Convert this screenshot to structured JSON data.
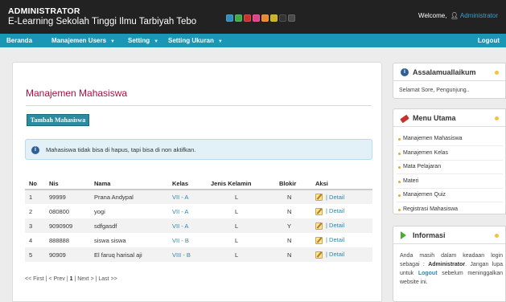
{
  "header": {
    "title_line1": "ADMINISTRATOR",
    "title_line2": "E-Learning Sekolah Tinggi Ilmu Tarbiyah Tebo",
    "welcome_label": "Welcome,",
    "user_name": "Administrator",
    "theme_colors": [
      "#2e8fbf",
      "#3dab4a",
      "#c8322e",
      "#e0428c",
      "#e9892c",
      "#c9b41f",
      "#333333",
      "#4a4a4a"
    ]
  },
  "nav": {
    "home": "Beranda",
    "users": "Manajemen Users",
    "setting": "Setting",
    "ukuran": "Setting Ukuran",
    "logout": "Logout"
  },
  "main": {
    "title": "Manajemen Mahasiswa",
    "add_button": "Tambah Mahasiswa",
    "notice_icon": "info-icon",
    "notice": "Mahasiswa tidak bisa di hapus, tapi bisa di non aktifkan.",
    "columns": [
      "No",
      "Nis",
      "Nama",
      "Kelas",
      "Jenis Kelamin",
      "Blokir",
      "Aksi"
    ],
    "rows": [
      {
        "no": "1",
        "nis": "99999",
        "nama": "Prana Andypal",
        "kelas": "VII - A",
        "jk": "L",
        "blokir": "N",
        "detail": "| Detail"
      },
      {
        "no": "2",
        "nis": "080800",
        "nama": "yogi",
        "kelas": "VII - A",
        "jk": "L",
        "blokir": "N",
        "detail": "| Detail"
      },
      {
        "no": "3",
        "nis": "9090909",
        "nama": "sdfgasdf",
        "kelas": "VII - A",
        "jk": "L",
        "blokir": "Y",
        "detail": "| Detail"
      },
      {
        "no": "4",
        "nis": "888888",
        "nama": "siswa siswa",
        "kelas": "VII - B",
        "jk": "L",
        "blokir": "N",
        "detail": "| Detail"
      },
      {
        "no": "5",
        "nis": "90909",
        "nama": "El faruq harisal aji",
        "kelas": "VIII - B",
        "jk": "L",
        "blokir": "N",
        "detail": "| Detail"
      }
    ],
    "pager": {
      "first": "<< First",
      "sep1": " | ",
      "prev": "< Prev",
      "sep2": " | ",
      "current": "1",
      "sep3": " | ",
      "next": "Next >",
      "sep4": " | ",
      "last": "Last >>"
    }
  },
  "sidebar": {
    "greeting": {
      "title": "Assalamuallaikum",
      "icon": "info-icon",
      "text": "Selamat Sore, Pengunjung.."
    },
    "menu": {
      "title": "Menu Utama",
      "icon": "pencil-icon",
      "items": [
        "Manajemen Mahasiswa",
        "Manajemen Kelas",
        "Mata Pelajaran",
        "Materi",
        "Manajemen Quiz",
        "Registrasi Mahasiswa"
      ]
    },
    "info": {
      "title": "Informasi",
      "icon": "arrow-right-icon",
      "line1": "Anda masih dalam keadaan login sebagai : ",
      "role": "Administrator",
      "line2": ". Jangan lupa untuk ",
      "logout": "Logout",
      "line3": " sebelum meninggalkan website ini."
    }
  }
}
